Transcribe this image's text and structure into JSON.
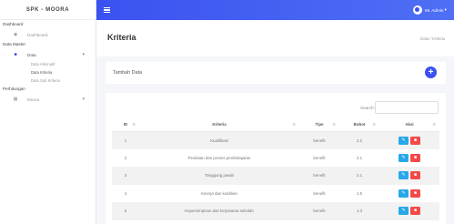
{
  "brand": "SPK - MOORA",
  "sidebar": {
    "sections": [
      "Dashboard",
      "Data Master",
      "Perhitungan"
    ],
    "dashboard_item": "Dashboard",
    "data_item": "Data",
    "sub_items": [
      "Data Alternatif",
      "Data Kriteria",
      "Data Sub Kriteria"
    ],
    "moora_item": "Moora"
  },
  "topbar": {
    "user_name": "Mr. Admin"
  },
  "header": {
    "title": "Kriteria",
    "breadcrumb": "Data / Kriteria"
  },
  "tambah": {
    "label": "Tambah Data",
    "button": "+"
  },
  "table": {
    "search_label": "Search:",
    "headers": [
      "ID",
      "Kriteria",
      "Tipe",
      "Bobot",
      "Aksi"
    ],
    "rows": [
      {
        "id": "1",
        "kriteria": "Kualifikasi",
        "tipe": "benefit",
        "bobot": "2.2"
      },
      {
        "id": "2",
        "kriteria": "Penilaian dan proses pembelajaran",
        "tipe": "benefit",
        "bobot": "2.1"
      },
      {
        "id": "3",
        "kriteria": "Tanggung jawab",
        "tipe": "benefit",
        "bobot": "2.1"
      },
      {
        "id": "4",
        "kriteria": "Kinerja dan keahlian",
        "tipe": "benefit",
        "bobot": "1.5"
      },
      {
        "id": "5",
        "kriteria": "Kepemimpinan dan kerjasama sekolah",
        "tipe": "benefit",
        "bobot": "1.3"
      }
    ]
  },
  "icons": {
    "menu": "hamburger-icon",
    "user": "user-avatar-icon",
    "dashboard": "dashboard-icon",
    "data": "folder-icon",
    "moora": "calculator-icon",
    "edit": "edit-icon",
    "delete": "trash-icon",
    "sort": "sort-icon"
  },
  "colors": {
    "primary": "#3a52f0",
    "edit": "#28a8e8",
    "delete": "#f24a4a"
  }
}
